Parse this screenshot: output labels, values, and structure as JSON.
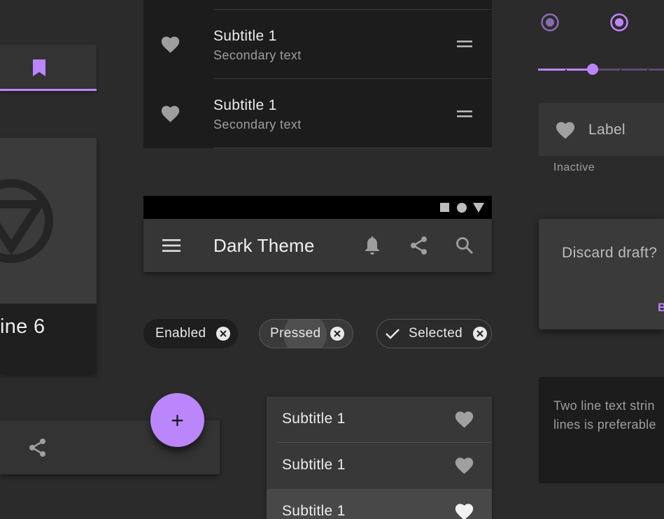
{
  "colors": {
    "accent": "#bb86fc",
    "background": "#2b2b2b",
    "surface": "#363636"
  },
  "left": {
    "tab": {
      "icon": "bookmark-icon"
    },
    "card": {
      "title": "ine 6",
      "media_icon": "logo-icon"
    },
    "bottom_bar": {
      "icon": "share-icon"
    }
  },
  "top_list": {
    "items": [
      {
        "primary": "Subtitle 1",
        "secondary": "Secondary text",
        "icon": "heart-icon",
        "handle": "drag-handle-icon"
      },
      {
        "primary": "Subtitle 1",
        "secondary": "Secondary text",
        "icon": "heart-icon",
        "handle": "drag-handle-icon"
      }
    ]
  },
  "app_bar": {
    "title": "Dark Theme",
    "status_icons": [
      "square-icon",
      "circle-icon",
      "triangle-icon"
    ],
    "actions": [
      "bell-icon",
      "share-icon",
      "search-icon"
    ],
    "nav_icon": "menu-icon"
  },
  "chips": [
    {
      "label": "Enabled",
      "state": "enabled"
    },
    {
      "label": "Pressed",
      "state": "pressed"
    },
    {
      "label": "Selected",
      "state": "selected"
    }
  ],
  "fab": {
    "symbol": "+"
  },
  "bottom_list": {
    "items": [
      {
        "label": "Subtitle 1"
      },
      {
        "label": "Subtitle 1"
      },
      {
        "label": "Subtitle 1"
      }
    ]
  },
  "right": {
    "slider": {
      "value_fraction": 0.4
    },
    "field": {
      "label": "Label",
      "helper": "Inactive"
    },
    "dialog": {
      "title": "Discard draft?",
      "action_partial": "B"
    },
    "snackbar": {
      "line1": "Two line text strin",
      "line2": "lines is preferable"
    }
  }
}
